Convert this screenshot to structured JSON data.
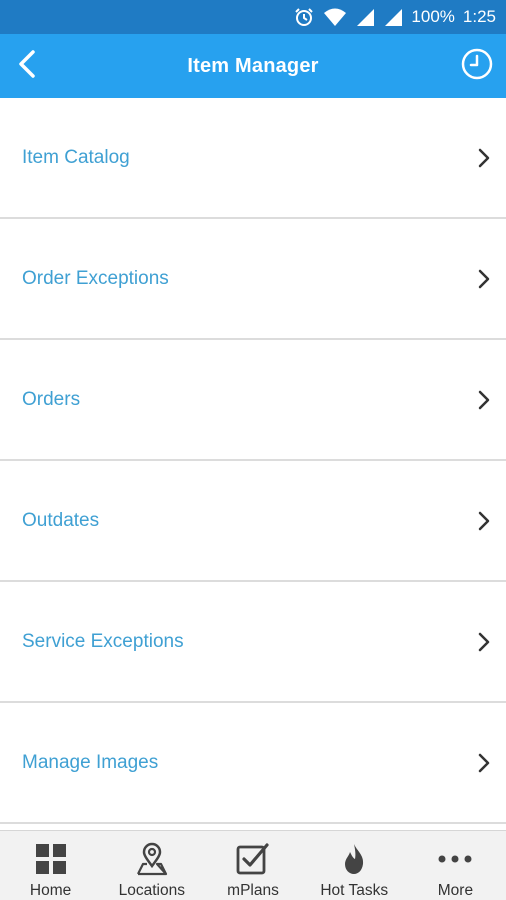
{
  "status_bar": {
    "battery": "100%",
    "time": "1:25",
    "icons": [
      "alarm-icon",
      "wifi-icon",
      "signal-icon",
      "signal-icon"
    ]
  },
  "header": {
    "title": "Item Manager",
    "back_icon": "chevron-left-icon",
    "right_icon": "clock-icon"
  },
  "menu": {
    "items": [
      {
        "label": "Item Catalog"
      },
      {
        "label": "Order Exceptions"
      },
      {
        "label": "Orders"
      },
      {
        "label": "Outdates"
      },
      {
        "label": "Service Exceptions"
      },
      {
        "label": "Manage Images"
      }
    ]
  },
  "bottom_nav": {
    "items": [
      {
        "label": "Home",
        "icon": "grid-icon"
      },
      {
        "label": "Locations",
        "icon": "map-pin-icon"
      },
      {
        "label": "mPlans",
        "icon": "checkbox-icon"
      },
      {
        "label": "Hot Tasks",
        "icon": "flame-icon"
      },
      {
        "label": "More",
        "icon": "more-dots-icon"
      }
    ]
  },
  "colors": {
    "status_bar": "#1f7bc4",
    "app_bar": "#27a1ef",
    "item_text": "#3fa0d3",
    "divider": "#dcdcdc",
    "nav_bg": "#f2f2f2"
  }
}
